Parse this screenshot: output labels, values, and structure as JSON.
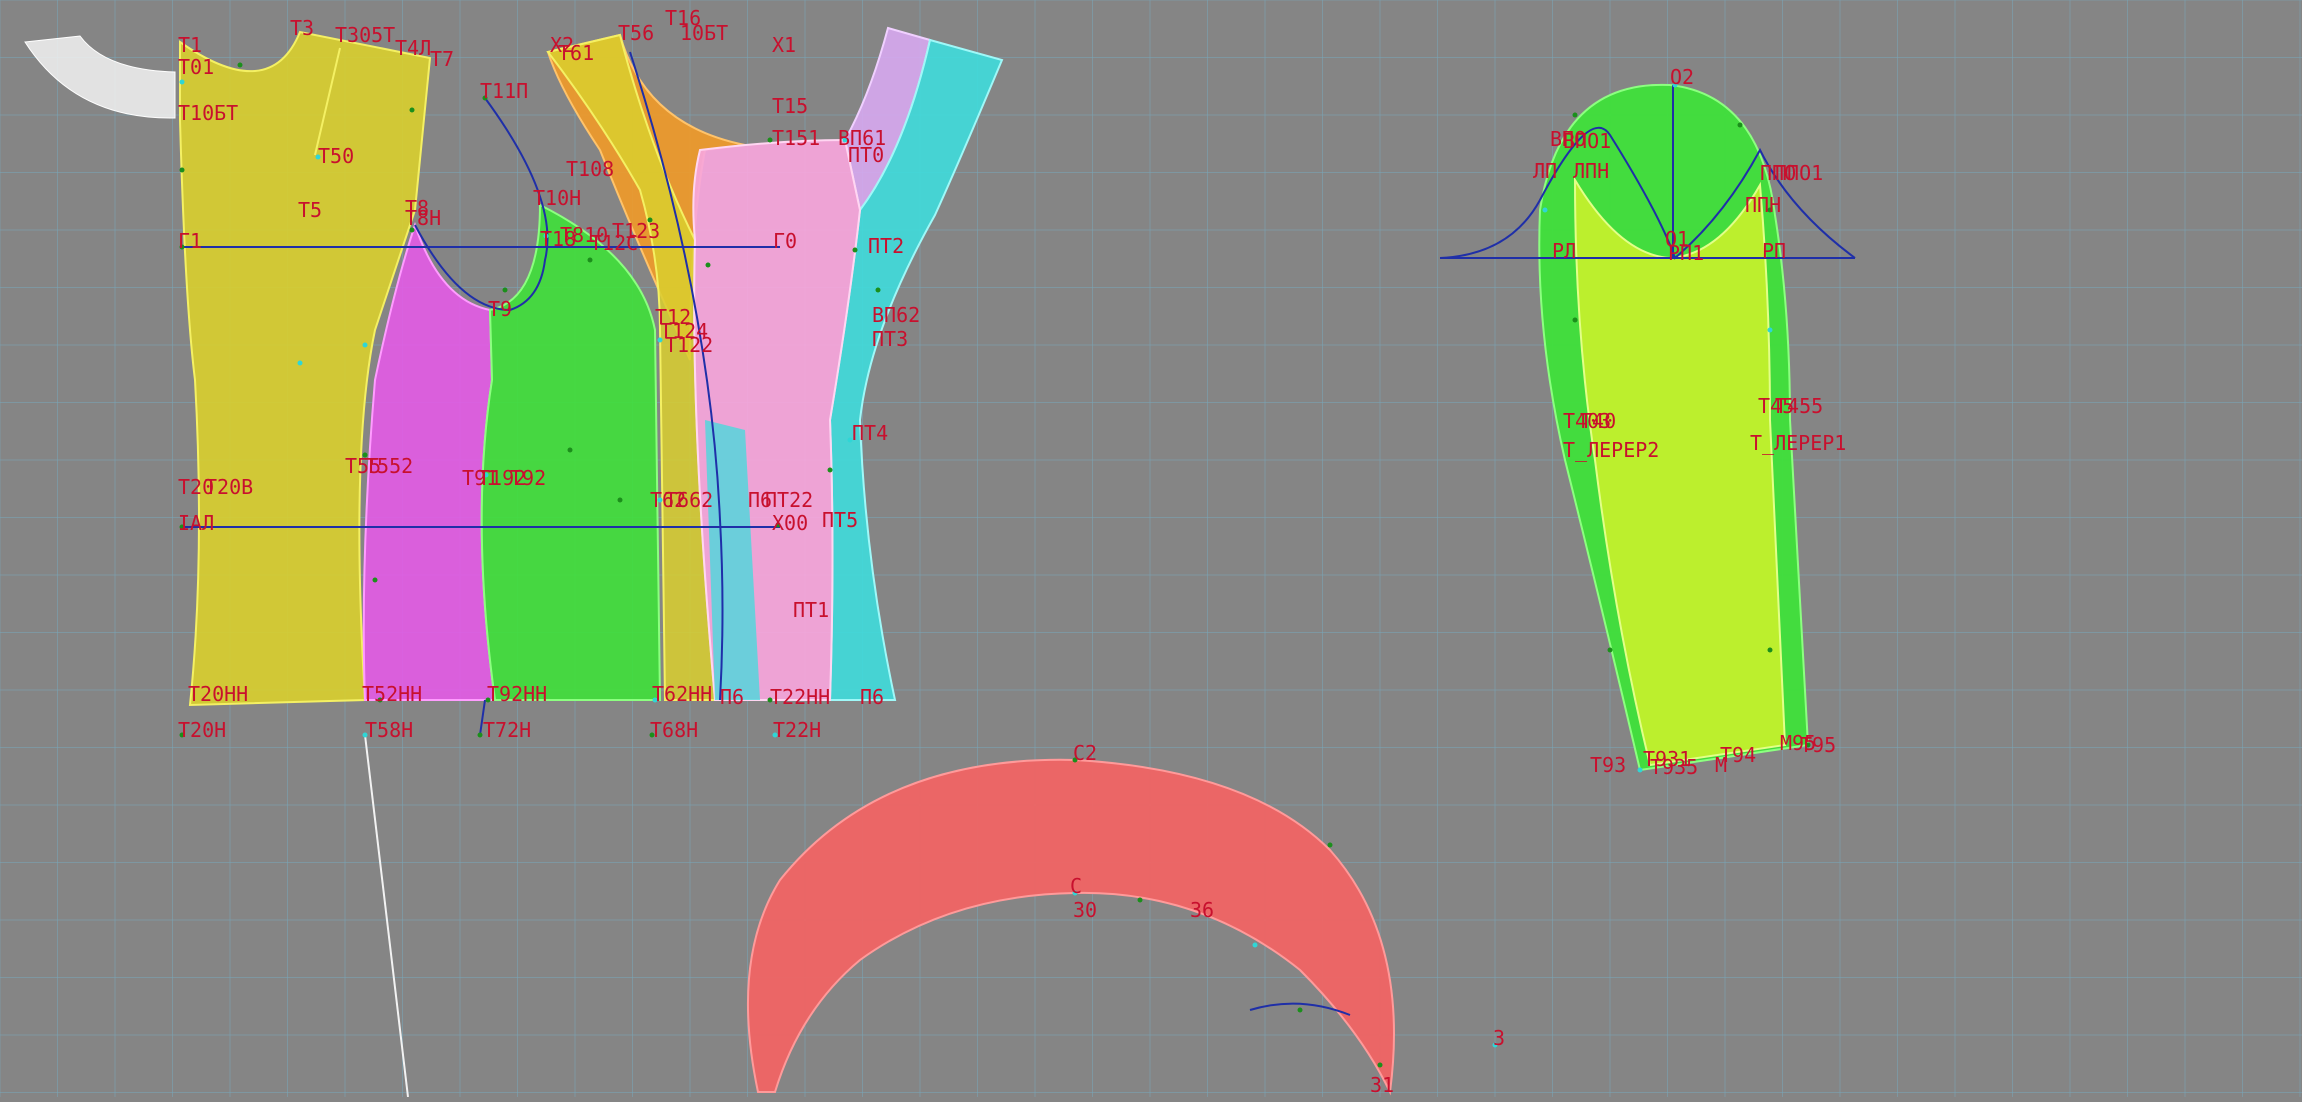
{
  "colors": {
    "background": "#858585",
    "grid": "#7aa6b8",
    "label": "#c8102e",
    "yellow_panel": "#d9cf2e",
    "magenta_panel": "#e35be6",
    "green_panel": "#3fe03a",
    "orange_panel": "#f19a28",
    "pink_panel": "#f7a6dc",
    "cyan_panel": "#3fdcdc",
    "lavender_panel": "#d7a8f0",
    "sleeve_outer": "#3fe03a",
    "sleeve_inner": "#c3ef2c",
    "collar": "#f06464",
    "construction_line": "#1f2fa8",
    "white_piece": "#f2f2f2"
  },
  "labels": {
    "t1": "T1",
    "t01": "T01",
    "t10bt": "T10БT",
    "t3": "T3",
    "t305t": "T305T",
    "t4l": "T4Л",
    "t7": "T7",
    "t11p": "T11П",
    "x2": "X2",
    "t61": "T61",
    "t56": "T56",
    "t16": "T16",
    "t10bt2": "10БT",
    "x1": "X1",
    "t50": "T50",
    "t15": "T15",
    "t151": "T151",
    "vp61": "ВП61",
    "pt0": "ПТ0",
    "t108": "T108",
    "t5": "T5",
    "t8": "T8",
    "t8n": "T8Н",
    "t10n": "T10Н",
    "g1": "Г1",
    "t18": "T18",
    "t810": "T810",
    "t123": "T123",
    "t12c": "T12С",
    "g0": "Г0",
    "pt2": "ПТ2",
    "t9": "T9",
    "t12": "T12",
    "t124": "T124",
    "t122": "T122",
    "vp62": "ВП62",
    "pt3": "ПТ3",
    "pt4": "ПТ4",
    "t55": "T55",
    "t552": "T552",
    "t20": "T20",
    "t20v": "T20В",
    "t91": "T91",
    "t92": "T92",
    "t192": "T192",
    "t62": "T62",
    "t662": "T662",
    "p6": "П6",
    "pt22": "ПТ22",
    "ial": "IАЛ",
    "x00": "X00",
    "pt5": "ПТ5",
    "pt1": "ПТ1",
    "t20nn": "T20НН",
    "t52nn": "T52НН",
    "t92nn": "T92НН",
    "t62nn": "T62НН",
    "p6b": "П6",
    "t22nn": "T22НН",
    "p6c": "П6",
    "t20n": "T20Н",
    "t58n": "T58Н",
    "t72n": "T72Н",
    "t68n": "T68Н",
    "t22n": "T22Н",
    "o2": "O2",
    "vpo": "ВПО",
    "vpo1": "ВПО1",
    "lp": "ЛП",
    "lpn": "ЛПН",
    "ppo": "ППО",
    "ppo1": "ППО1",
    "ppn": "ППН",
    "rl": "РЛ",
    "o1": "O1",
    "rp": "РП",
    "rp1": "РП1",
    "t403": "T403",
    "t40": "T40",
    "t45": "T45",
    "t455": "T455",
    "t_lep2": "T_ЛЕРЕР2",
    "t_lep1": "T_ЛЕРЕР1",
    "t93": "T93",
    "t931": "T931",
    "t935": "T935",
    "m": "M",
    "t94": "T94",
    "m95": "M95",
    "t95": "T95",
    "c2": "C2",
    "c": "C",
    "n30": "30",
    "n36": "36",
    "n3": "3",
    "n31": "31"
  }
}
